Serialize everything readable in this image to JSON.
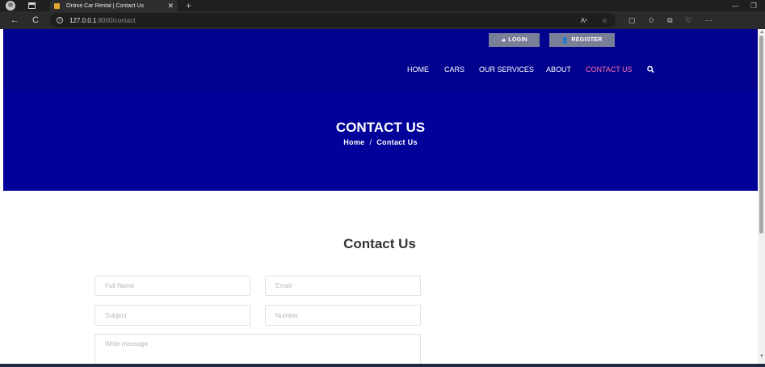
{
  "browser": {
    "tab_title": "Online Car Rental | Contact Us",
    "tab_close": "✕",
    "new_tab": "+",
    "back": "←",
    "reload": "C",
    "info": "i",
    "url_host": "127.0.0.1",
    "url_path": ":8000/contact",
    "read_aloud": "A¹",
    "favorite": "☆",
    "split": "▢",
    "favorites": "✩",
    "collections": "⧉",
    "copilot": "♡",
    "more": "···",
    "minimize": "—",
    "restore": "❐"
  },
  "header": {
    "login_label": "LOGIN",
    "register_label": "REGISTER",
    "nav": [
      {
        "label": "HOME"
      },
      {
        "label": "CARS"
      },
      {
        "label": "OUR SERVICES"
      },
      {
        "label": "ABOUT"
      },
      {
        "label": "CONTACT US"
      }
    ]
  },
  "banner": {
    "title": "CONTACT US",
    "breadcrumb_home": "Home",
    "breadcrumb_sep": "/",
    "breadcrumb_current": "Contact Us"
  },
  "contact": {
    "title": "Contact Us",
    "full_name_placeholder": "Full Name",
    "email_placeholder": "Email",
    "subject_placeholder": "Subject",
    "number_placeholder": "Number",
    "message_placeholder": "Write message"
  },
  "colors": {
    "header_bg": "#02028f",
    "banner_bg": "#02029a",
    "active_nav": "#ff6fa8",
    "auth_button": "#7a7f98"
  }
}
